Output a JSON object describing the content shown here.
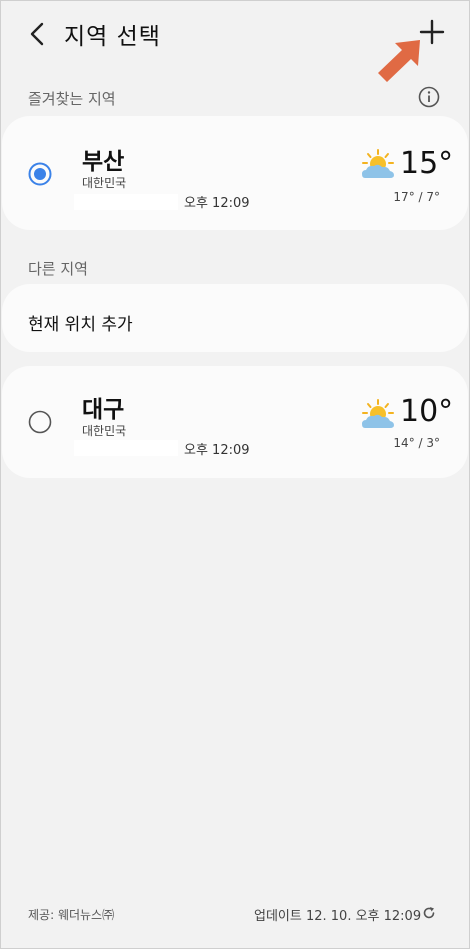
{
  "header": {
    "title": "지역 선택"
  },
  "favorites": {
    "label": "즐겨찾는 지역",
    "items": [
      {
        "city": "부산",
        "country": "대한민국",
        "time": "오후 12:09",
        "weather_icon": "partly-cloudy-sun-icon",
        "temp": "15°",
        "range": "17° / 7°",
        "selected": true
      }
    ]
  },
  "others": {
    "label": "다른 지역",
    "add_current": "현재 위치 추가",
    "items": [
      {
        "city": "대구",
        "country": "대한민국",
        "time": "오후 12:09",
        "weather_icon": "partly-cloudy-sun-icon",
        "temp": "10°",
        "range": "14° / 3°",
        "selected": false
      }
    ]
  },
  "footer": {
    "source": "제공: 웨더뉴스㈜",
    "updated": "업데이트 12. 10. 오후 12:09"
  },
  "colors": {
    "accent": "#3b82e8",
    "annotation_arrow": "#e06a44"
  }
}
